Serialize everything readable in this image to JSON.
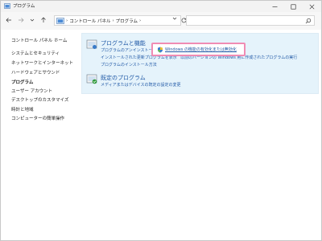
{
  "window": {
    "title": "プログラム"
  },
  "address": {
    "crumbs": [
      "コントロール パネル",
      "プログラム"
    ],
    "search_placeholder": ""
  },
  "sidebar": {
    "home": "コントロール パネル ホーム",
    "items": [
      {
        "label": "システムとセキュリティ",
        "active": false
      },
      {
        "label": "ネットワークとインターネット",
        "active": false
      },
      {
        "label": "ハードウェアとサウンド",
        "active": false
      },
      {
        "label": "プログラム",
        "active": true
      },
      {
        "label": "ユーザー アカウント",
        "active": false
      },
      {
        "label": "デスクトップのカスタマイズ",
        "active": false
      },
      {
        "label": "時計と地域",
        "active": false
      },
      {
        "label": "コンピューターの簡単操作",
        "active": false
      }
    ]
  },
  "categories": [
    {
      "title": "プログラムと機能",
      "links": [
        "プログラムのアンインストール",
        "Windows の機能の有効化または無効化",
        "インストールされた更新プログラムを表示",
        "以前のバージョンの Windows 用に作成されたプログラムの実行",
        "プログラムのインストール方法"
      ]
    },
    {
      "title": "既定のプログラム",
      "links": [
        "メディアまたはデバイスの既定の設定の変更"
      ]
    }
  ],
  "colors": {
    "link": "#1f58a6",
    "panel_bg": "#e5f3fb",
    "highlight_border": "#f08cb4"
  }
}
